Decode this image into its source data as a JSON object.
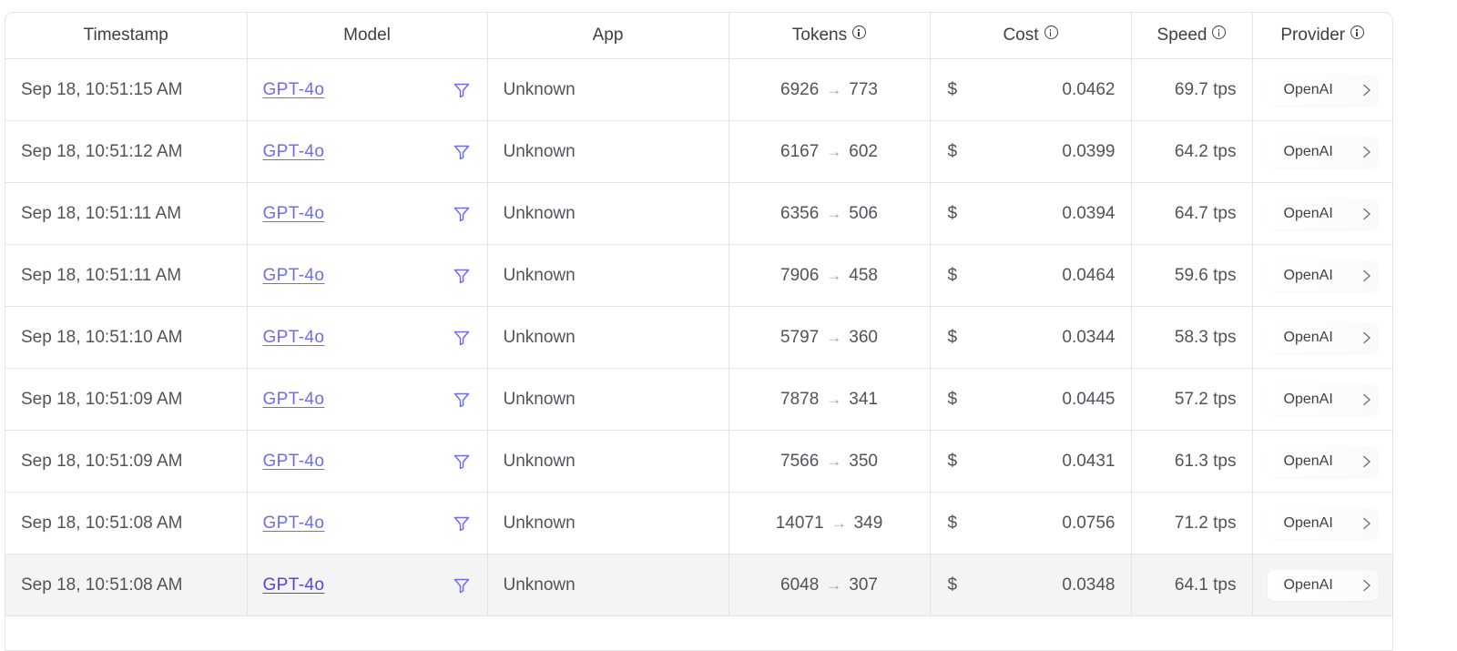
{
  "table": {
    "headers": {
      "timestamp": "Timestamp",
      "model": "Model",
      "app": "App",
      "tokens": "Tokens",
      "cost": "Cost",
      "speed": "Speed",
      "provider": "Provider"
    },
    "header_icons": {
      "tokens": "info-icon",
      "cost": "info-icon",
      "speed": "info-icon",
      "provider": "info-icon"
    },
    "rows": [
      {
        "timestamp": "Sep 18, 10:51:15 AM",
        "model": "GPT-4o",
        "app": "Unknown",
        "tokens_in": "6926",
        "tokens_out": "773",
        "cost_symbol": "$",
        "cost": "0.0462",
        "speed": "69.7 tps",
        "provider": "OpenAI"
      },
      {
        "timestamp": "Sep 18, 10:51:12 AM",
        "model": "GPT-4o",
        "app": "Unknown",
        "tokens_in": "6167",
        "tokens_out": "602",
        "cost_symbol": "$",
        "cost": "0.0399",
        "speed": "64.2 tps",
        "provider": "OpenAI"
      },
      {
        "timestamp": "Sep 18, 10:51:11 AM",
        "model": "GPT-4o",
        "app": "Unknown",
        "tokens_in": "6356",
        "tokens_out": "506",
        "cost_symbol": "$",
        "cost": "0.0394",
        "speed": "64.7 tps",
        "provider": "OpenAI"
      },
      {
        "timestamp": "Sep 18, 10:51:11 AM",
        "model": "GPT-4o",
        "app": "Unknown",
        "tokens_in": "7906",
        "tokens_out": "458",
        "cost_symbol": "$",
        "cost": "0.0464",
        "speed": "59.6 tps",
        "provider": "OpenAI"
      },
      {
        "timestamp": "Sep 18, 10:51:10 AM",
        "model": "GPT-4o",
        "app": "Unknown",
        "tokens_in": "5797",
        "tokens_out": "360",
        "cost_symbol": "$",
        "cost": "0.0344",
        "speed": "58.3 tps",
        "provider": "OpenAI"
      },
      {
        "timestamp": "Sep 18, 10:51:09 AM",
        "model": "GPT-4o",
        "app": "Unknown",
        "tokens_in": "7878",
        "tokens_out": "341",
        "cost_symbol": "$",
        "cost": "0.0445",
        "speed": "57.2 tps",
        "provider": "OpenAI"
      },
      {
        "timestamp": "Sep 18, 10:51:09 AM",
        "model": "GPT-4o",
        "app": "Unknown",
        "tokens_in": "7566",
        "tokens_out": "350",
        "cost_symbol": "$",
        "cost": "0.0431",
        "speed": "61.3 tps",
        "provider": "OpenAI"
      },
      {
        "timestamp": "Sep 18, 10:51:08 AM",
        "model": "GPT-4o",
        "app": "Unknown",
        "tokens_in": "14071",
        "tokens_out": "349",
        "cost_symbol": "$",
        "cost": "0.0756",
        "speed": "71.2 tps",
        "provider": "OpenAI"
      },
      {
        "timestamp": "Sep 18, 10:51:08 AM",
        "model": "GPT-4o",
        "app": "Unknown",
        "tokens_in": "6048",
        "tokens_out": "307",
        "cost_symbol": "$",
        "cost": "0.0348",
        "speed": "64.1 tps",
        "provider": "OpenAI",
        "hovered": true
      }
    ],
    "row_icons": {
      "model_filter": "filter-icon",
      "tokens_arrow": "arrow-right-icon",
      "provider_chevron": "chevron-right-icon"
    },
    "tokens_arrow_glyph": "→"
  },
  "colors": {
    "link": "#6d6ee8",
    "border": "#e4e4e7",
    "hover_row": "#f4f4f5",
    "text": "#52525b",
    "muted": "#a1a1aa"
  }
}
